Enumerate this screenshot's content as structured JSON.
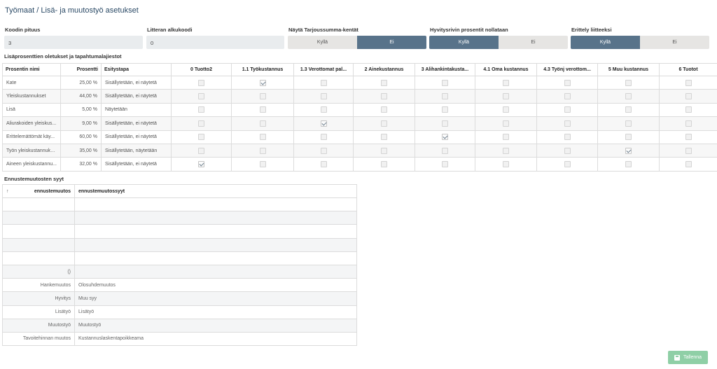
{
  "page": {
    "title": "Työmaat / Lisä- ja muutostyö asetukset"
  },
  "fields": {
    "code_length": {
      "label": "Koodin pituus",
      "value": "3"
    },
    "litter_prefix": {
      "label": "Litteran alkukoodi",
      "value": "0"
    }
  },
  "toggles": {
    "show_offer_sum": {
      "label": "Näytä Tarjoussumma-kentät",
      "yes": "Kyllä",
      "no": "Ei",
      "selected": "no"
    },
    "reset_credit": {
      "label": "Hyvitysrivin prosentit nollataan",
      "yes": "Kyllä",
      "no": "Ei",
      "selected": "yes"
    },
    "separate_attachments": {
      "label": "Erittely liitteeksi",
      "yes": "Kyllä",
      "no": "Ei",
      "selected": "yes"
    }
  },
  "surcharge": {
    "section_title": "Lisäprosenttien oletukset ja tapahtumalajiestot",
    "headers": [
      "Prosentin nimi",
      "Prosentti",
      "Esitystapa",
      "0 Tuotto2",
      "1.1 Työkustannus",
      "1.3 Verottomat pal...",
      "2 Ainekustannus",
      "3 Alihankintakusta...",
      "4.1 Oma kustannus",
      "4.3 Työnj verottom...",
      "5 Muu kustannus",
      "6 Tuotot"
    ],
    "rows": [
      {
        "name": "Kate",
        "percent": "25,00 %",
        "display": "Sisällytetään, ei näytetä",
        "checks": [
          false,
          true,
          false,
          false,
          false,
          false,
          false,
          false,
          false
        ]
      },
      {
        "name": "Yleiskustannukset",
        "percent": "44,00 %",
        "display": "Sisällytetään, ei näytetä",
        "checks": [
          false,
          false,
          false,
          false,
          false,
          false,
          false,
          false,
          false
        ]
      },
      {
        "name": "Lisä",
        "percent": "5,00 %",
        "display": "Näytetään",
        "checks": [
          false,
          false,
          false,
          false,
          false,
          false,
          false,
          false,
          false
        ]
      },
      {
        "name": "Aliurakoiden yleiskus...",
        "percent": "9,00 %",
        "display": "Sisällytetään, ei näytetä",
        "checks": [
          false,
          false,
          true,
          false,
          false,
          false,
          false,
          false,
          false
        ]
      },
      {
        "name": "Erittelemättömät käy...",
        "percent": "60,00 %",
        "display": "Sisällytetään, ei näytetä",
        "checks": [
          false,
          false,
          false,
          false,
          true,
          false,
          false,
          false,
          false
        ]
      },
      {
        "name": "Työn yleiskustannukset",
        "percent": "35,00 %",
        "display": "Sisällytetään, näytetään",
        "checks": [
          false,
          false,
          false,
          false,
          false,
          false,
          false,
          true,
          false
        ]
      },
      {
        "name": "Aineen yleiskustannu...",
        "percent": "32,00 %",
        "display": "Sisällytetään, ei näytetä",
        "checks": [
          true,
          false,
          false,
          false,
          false,
          false,
          false,
          false,
          false
        ]
      }
    ]
  },
  "causes": {
    "section_title": "Ennustemuutosten syyt",
    "sort_icon": "↑",
    "headers": [
      "ennustemuutos",
      "ennustemuutossyyt"
    ],
    "rows": [
      [
        "",
        ""
      ],
      [
        "",
        ""
      ],
      [
        "",
        ""
      ],
      [
        "",
        ""
      ],
      [
        "",
        ""
      ],
      [
        "()",
        ""
      ],
      [
        "Hankemuutos",
        "Olosuhdemuutos"
      ],
      [
        "Hyvitys",
        "Muu syy"
      ],
      [
        "Lisätyö",
        "Lisätyö"
      ],
      [
        "Muutostyö",
        "Muutostyö"
      ],
      [
        "Tavoitehinnan muutos",
        "Kustannuslaskentapoikkeama"
      ]
    ]
  },
  "actions": {
    "save_label": "Tallenna",
    "save_color": "#8fcfa6"
  }
}
